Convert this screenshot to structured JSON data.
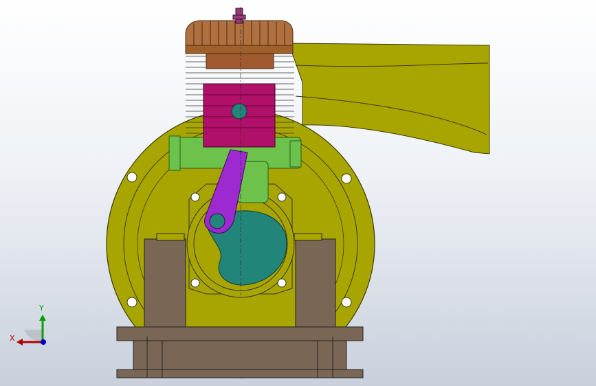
{
  "view": {
    "triad": {
      "x_label": "X",
      "y_label": "Y",
      "x_color": "#b00000",
      "y_color": "#00a000",
      "z_color": "#0000c0"
    }
  },
  "parts": {
    "housing": {
      "color": "#a9a500"
    },
    "fins": {
      "color": "#b07040"
    },
    "cylinder": {
      "color": "#b0106a"
    },
    "crankshaft": {
      "color": "#22857a"
    },
    "connecting_rod": {
      "color": "#9c2ad0"
    },
    "carburetor": {
      "color": "#6cc24a"
    },
    "base": {
      "color": "#7a6655"
    },
    "spark_plug": {
      "color": "#9a3a7a"
    }
  }
}
